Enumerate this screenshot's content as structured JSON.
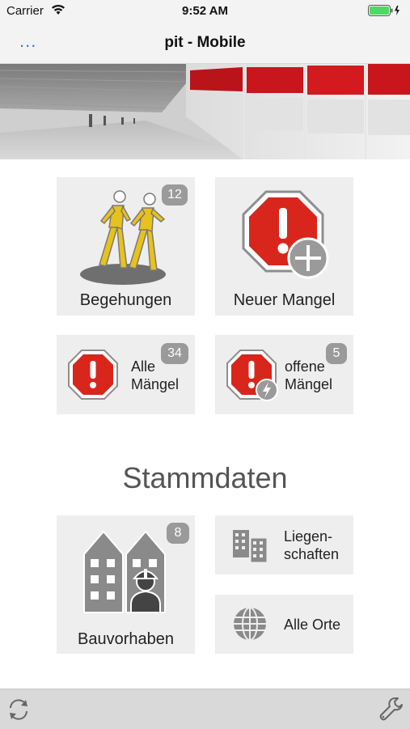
{
  "status": {
    "carrier": "Carrier",
    "time": "9:52 AM"
  },
  "nav": {
    "more_label": "...",
    "title": "pit - Mobile"
  },
  "tiles": {
    "begehungen": {
      "label": "Begehungen",
      "badge": "12"
    },
    "neuer_mangel": {
      "label": "Neuer Mangel"
    },
    "alle_maengel": {
      "line1": "Alle",
      "line2": "Mängel",
      "badge": "34"
    },
    "offene_maengel": {
      "line1": "offene",
      "line2": "Mängel",
      "badge": "5"
    }
  },
  "stammdaten": {
    "title": "Stammdaten",
    "bauvorhaben": {
      "label": "Bauvorhaben",
      "badge": "8"
    },
    "liegenschaften": {
      "line1": "Liegen-",
      "line2": "schaften"
    },
    "alle_orte": {
      "label": "Alle Orte"
    }
  },
  "toolbar": {
    "refresh_icon": "refresh-icon",
    "settings_icon": "wrench-icon"
  },
  "colors": {
    "accent": "#2b7de9",
    "tile_bg": "#eeeeee",
    "badge": "#9a9a9a",
    "warning_red": "#d9261c",
    "walker_yellow": "#e8c21a"
  }
}
